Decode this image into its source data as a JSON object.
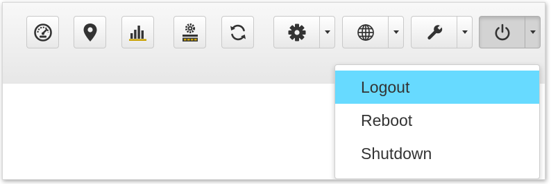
{
  "toolbar": {
    "buttons": [
      {
        "icon": "dashboard-icon",
        "has_caret": false
      },
      {
        "icon": "map-marker-icon",
        "has_caret": false
      },
      {
        "icon": "bar-chart-icon",
        "has_caret": false
      },
      {
        "icon": "network-settings-icon",
        "has_caret": false
      },
      {
        "icon": "refresh-icon",
        "has_caret": false
      },
      {
        "icon": "gear-icon",
        "has_caret": true
      },
      {
        "icon": "globe-icon",
        "has_caret": true
      },
      {
        "icon": "wrench-icon",
        "has_caret": true
      },
      {
        "icon": "power-icon",
        "has_caret": true,
        "active": true
      }
    ]
  },
  "power_menu": {
    "items": [
      {
        "label": "Logout",
        "highlighted": true
      },
      {
        "label": "Reboot"
      },
      {
        "label": "Shutdown"
      }
    ]
  },
  "colors": {
    "highlight": "#67daff",
    "text": "#333333",
    "icon": "#3a3a3a",
    "chart_accent": "#c9a000"
  }
}
